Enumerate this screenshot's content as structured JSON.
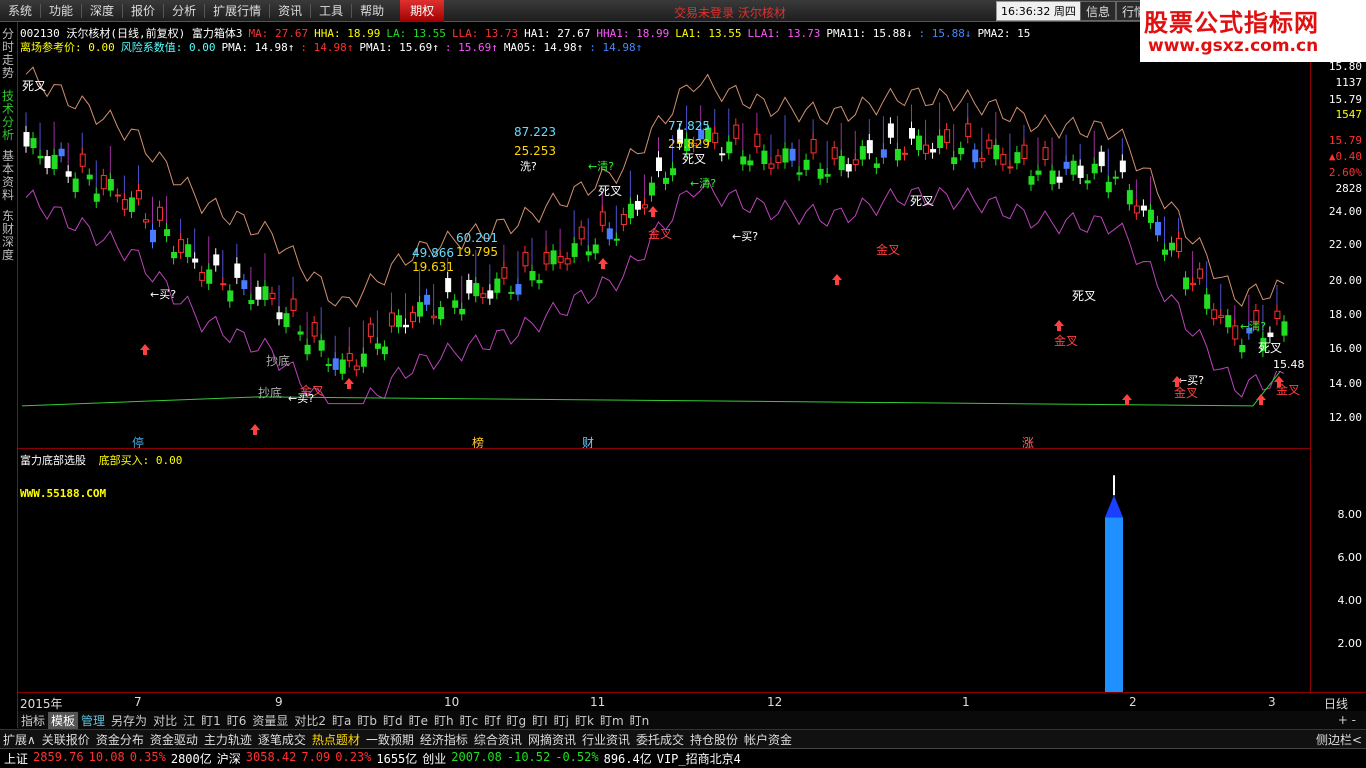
{
  "menu": [
    "系统",
    "功能",
    "深度",
    "报价",
    "分析",
    "扩展行情",
    "资讯",
    "工具",
    "帮助"
  ],
  "menu_highlight": "期权",
  "top_status": "交易未登录  沃尔核材",
  "clock": "16:36:32 周四",
  "top_buttons": [
    "信息",
    "行情"
  ],
  "logo": {
    "line1": "股票公式指标网",
    "line2": "www.gsxz.com.cn"
  },
  "left_tabs": [
    "分时走势",
    "技术分析",
    "基本资料",
    "东财深度"
  ],
  "header1": {
    "title": "002130 沃尔核材(日线,前复权) 富力箱体3",
    "items": [
      {
        "t": "MA: 27.67",
        "c": "red"
      },
      {
        "t": "HHA: 18.99",
        "c": "yel"
      },
      {
        "t": "LA: 13.55",
        "c": "green"
      },
      {
        "t": "LLA: 13.73",
        "c": "red"
      },
      {
        "t": "HA1: 27.67",
        "c": "wht"
      },
      {
        "t": "HHA1: 18.99",
        "c": "mag"
      },
      {
        "t": "LA1: 13.55",
        "c": "yel"
      },
      {
        "t": "LLA1: 13.73",
        "c": "mag"
      },
      {
        "t": "PMA11: 15.88↓",
        "c": "wht"
      },
      {
        "t": ": 15.88↓",
        "c": "blue"
      },
      {
        "t": "PMA2: 15",
        "c": "wht"
      }
    ]
  },
  "header2": {
    "items": [
      {
        "t": "离场参考价: 0.00",
        "c": "yel"
      },
      {
        "t": "风险系数值: 0.00",
        "c": "cyan"
      },
      {
        "t": "PMA: 14.98↑",
        "c": "wht"
      },
      {
        "t": ": 14.98↑",
        "c": "red"
      },
      {
        "t": "PMA1: 15.69↑",
        "c": "wht"
      },
      {
        "t": ": 15.69↑",
        "c": "mag"
      },
      {
        "t": "MA05: 14.98↑",
        "c": "wht"
      },
      {
        "t": ": 14.98↑",
        "c": "blue"
      }
    ]
  },
  "sub_header": {
    "title": "富力底部选股",
    "label": "底部买入: 0.00",
    "url": "WWW.55188.COM"
  },
  "price_axis": [
    "15.80",
    "1137",
    "15.79",
    "1547",
    "15.79",
    "▲0.40",
    "2.60%",
    "2828",
    "24.00",
    "22.00",
    "20.00",
    "18.00",
    "16.00",
    "14.00",
    "12.00"
  ],
  "cur_price": "15.48",
  "sub_axis": [
    "8.00",
    "6.00",
    "4.00",
    "2.00"
  ],
  "x_labels": [
    "2015年",
    "7",
    "9",
    "10",
    "11",
    "12",
    "1",
    "2",
    "3",
    "日线"
  ],
  "chart_labels": {
    "die": "死叉",
    "jin": "金叉",
    "buy": "←买?",
    "clear": "←清?",
    "wash": "洗?",
    "bottom": "抄底",
    "peak1": "87.223",
    "peak1b": "25.253",
    "peak2": "77.825",
    "peak2b": "25.829",
    "v1": "49.866",
    "v1b": "19.631",
    "v2": "60.201",
    "v2b": "19.795",
    "m1": "停",
    "m2": "榜",
    "m3": "财",
    "m4": "涨"
  },
  "tabs": [
    "指标",
    "模板",
    "管理",
    "另存为",
    "对比",
    "江",
    "盯1",
    "盯6",
    "资量显",
    "对比2",
    "盯a",
    "盯b",
    "盯d",
    "盯e",
    "盯h",
    "盯c",
    "盯f",
    "盯g",
    "盯I",
    "盯j",
    "盯k",
    "盯m",
    "盯n"
  ],
  "tab_right": "+  -",
  "func": [
    "扩展∧",
    "关联报价",
    "资金分布",
    "资金驱动",
    "主力轨迹",
    "逐笔成交",
    "热点题材",
    "一致预期",
    "经济指标",
    "综合资讯",
    "网摘资讯",
    "行业资讯",
    "委托成交",
    "持仓股份",
    "帐户资金"
  ],
  "func_right": "侧边栏<",
  "status": [
    {
      "t": "上证",
      "c": "wht"
    },
    {
      "t": "2859.76",
      "c": "red"
    },
    {
      "t": "10.08",
      "c": "red"
    },
    {
      "t": "0.35%",
      "c": "red"
    },
    {
      "t": "2800亿",
      "c": "wht"
    },
    {
      "t": "沪深",
      "c": "wht"
    },
    {
      "t": "3058.42",
      "c": "red"
    },
    {
      "t": "7.09",
      "c": "red"
    },
    {
      "t": "0.23%",
      "c": "red"
    },
    {
      "t": "1655亿",
      "c": "wht"
    },
    {
      "t": "创业",
      "c": "wht"
    },
    {
      "t": "2007.08",
      "c": "green"
    },
    {
      "t": "-10.52",
      "c": "green"
    },
    {
      "t": "-0.52%",
      "c": "green"
    },
    {
      "t": "896.4亿",
      "c": "wht"
    },
    {
      "t": "VIP_招商北京4",
      "c": "wht"
    }
  ],
  "chart_data": {
    "type": "candlestick",
    "ylim": [
      11,
      26
    ],
    "indicator": {
      "type": "bar",
      "value": 9.5,
      "ylim": [
        0,
        10
      ]
    }
  }
}
